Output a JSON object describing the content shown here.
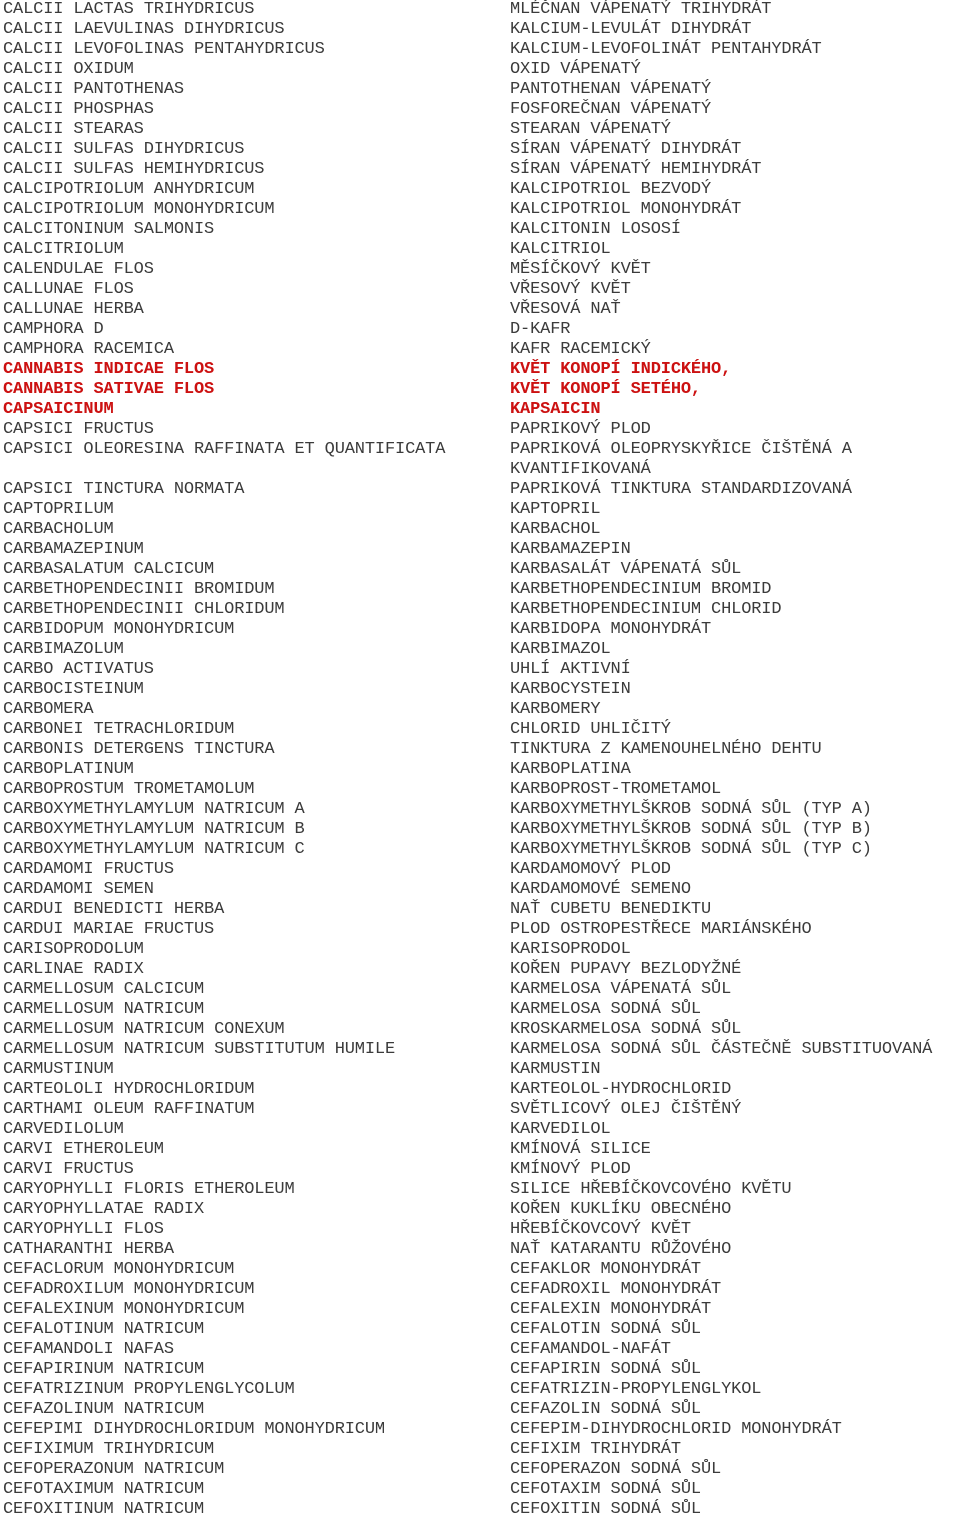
{
  "document": {
    "kind": "two-column-terminology-list",
    "language_left": "Latin",
    "language_right": "Czech",
    "highlight_color": "#cc1111",
    "text_color": "#3b3b3b",
    "background_color": "#ffffff"
  },
  "rows": [
    {
      "latin": "CALCII LACTAS TRIHYDRICUS",
      "czech": "MLÉČNAN VÁPENATÝ TRIHYDRÁT",
      "highlight": false
    },
    {
      "latin": "CALCII LAEVULINAS DIHYDRICUS",
      "czech": "KALCIUM-LEVULÁT DIHYDRÁT",
      "highlight": false
    },
    {
      "latin": "CALCII LEVOFOLINAS PENTAHYDRICUS",
      "czech": "KALCIUM-LEVOFOLINÁT PENTAHYDRÁT",
      "highlight": false
    },
    {
      "latin": "CALCII OXIDUM",
      "czech": "OXID VÁPENATÝ",
      "highlight": false
    },
    {
      "latin": "CALCII PANTOTHENAS",
      "czech": "PANTOTHENAN VÁPENATÝ",
      "highlight": false
    },
    {
      "latin": "CALCII PHOSPHAS",
      "czech": "FOSFOREČNAN VÁPENATÝ",
      "highlight": false
    },
    {
      "latin": "CALCII STEARAS",
      "czech": "STEARAN VÁPENATÝ",
      "highlight": false
    },
    {
      "latin": "CALCII SULFAS DIHYDRICUS",
      "czech": "SÍRAN VÁPENATÝ DIHYDRÁT",
      "highlight": false
    },
    {
      "latin": "CALCII SULFAS HEMIHYDRICUS",
      "czech": "SÍRAN VÁPENATÝ HEMIHYDRÁT",
      "highlight": false
    },
    {
      "latin": "CALCIPOTRIOLUM ANHYDRICUM",
      "czech": "KALCIPOTRIOL BEZVODÝ",
      "highlight": false
    },
    {
      "latin": "CALCIPOTRIOLUM MONOHYDRICUM",
      "czech": "KALCIPOTRIOL MONOHYDRÁT",
      "highlight": false
    },
    {
      "latin": "CALCITONINUM SALMONIS",
      "czech": "KALCITONIN LOSOSÍ",
      "highlight": false
    },
    {
      "latin": "CALCITRIOLUM",
      "czech": "KALCITRIOL",
      "highlight": false
    },
    {
      "latin": "CALENDULAE FLOS",
      "czech": "MĚSÍČKOVÝ KVĚT",
      "highlight": false
    },
    {
      "latin": "CALLUNAE FLOS",
      "czech": "VŘESOVÝ KVĚT",
      "highlight": false
    },
    {
      "latin": "CALLUNAE HERBA",
      "czech": "VŘESOVÁ NAŤ",
      "highlight": false
    },
    {
      "latin": "CAMPHORA D",
      "czech": "D-KAFR",
      "highlight": false
    },
    {
      "latin": "CAMPHORA RACEMICA",
      "czech": "KAFR RACEMICKÝ",
      "highlight": false
    },
    {
      "latin": "CANNABIS INDICAE FLOS",
      "czech": "KVĚT KONOPÍ INDICKÉHO,",
      "highlight": true
    },
    {
      "latin": "CANNABIS SATIVAE FLOS",
      "czech": "KVĚT KONOPÍ SETÉHO,",
      "highlight": true
    },
    {
      "latin": "CAPSAICINUM",
      "czech": "KAPSAICIN",
      "highlight": true
    },
    {
      "latin": "CAPSICI FRUCTUS",
      "czech": "PAPRIKOVÝ PLOD",
      "highlight": false
    },
    {
      "latin": "CAPSICI OLEORESINA RAFFINATA ET QUANTIFICATA",
      "czech": "PAPRIKOVÁ OLEOPRYSKYŘICE ČIŠTĚNÁ A KVANTIFIKOVANÁ",
      "highlight": false
    },
    {
      "latin": "CAPSICI TINCTURA NORMATA",
      "czech": "PAPRIKOVÁ TINKTURA STANDARDIZOVANÁ",
      "highlight": false
    },
    {
      "latin": "CAPTOPRILUM",
      "czech": "KAPTOPRIL",
      "highlight": false
    },
    {
      "latin": "CARBACHOLUM",
      "czech": "KARBACHOL",
      "highlight": false
    },
    {
      "latin": "CARBAMAZEPINUM",
      "czech": "KARBAMAZEPIN",
      "highlight": false
    },
    {
      "latin": "CARBASALATUM CALCICUM",
      "czech": "KARBASALÁT VÁPENATÁ SŮL",
      "highlight": false
    },
    {
      "latin": "CARBETHOPENDECINII BROMIDUM",
      "czech": "KARBETHOPENDECINIUM BROMID",
      "highlight": false
    },
    {
      "latin": "CARBETHOPENDECINII CHLORIDUM",
      "czech": "KARBETHOPENDECINIUM CHLORID",
      "highlight": false
    },
    {
      "latin": "CARBIDOPUM MONOHYDRICUM",
      "czech": "KARBIDOPA MONOHYDRÁT",
      "highlight": false
    },
    {
      "latin": "CARBIMAZOLUM",
      "czech": "KARBIMAZOL",
      "highlight": false
    },
    {
      "latin": "CARBO ACTIVATUS",
      "czech": "UHLÍ AKTIVNÍ",
      "highlight": false
    },
    {
      "latin": "CARBOCISTEINUM",
      "czech": "KARBOCYSTEIN",
      "highlight": false
    },
    {
      "latin": "CARBOMERA",
      "czech": "KARBOMERY",
      "highlight": false
    },
    {
      "latin": "CARBONEI TETRACHLORIDUM",
      "czech": "CHLORID UHLIČITÝ",
      "highlight": false
    },
    {
      "latin": "CARBONIS DETERGENS TINCTURA",
      "czech": "TINKTURA Z KAMENOUHELNÉHO DEHTU",
      "highlight": false
    },
    {
      "latin": "CARBOPLATINUM",
      "czech": "KARBOPLATINA",
      "highlight": false
    },
    {
      "latin": "CARBOPROSTUM TROMETAMOLUM",
      "czech": "KARBOPROST-TROMETAMOL",
      "highlight": false
    },
    {
      "latin": "CARBOXYMETHYLAMYLUM NATRICUM A",
      "czech": "KARBOXYMETHYLŠKROB SODNÁ SŮL (TYP A)",
      "highlight": false
    },
    {
      "latin": "CARBOXYMETHYLAMYLUM NATRICUM B",
      "czech": "KARBOXYMETHYLŠKROB SODNÁ SŮL (TYP B)",
      "highlight": false
    },
    {
      "latin": "CARBOXYMETHYLAMYLUM NATRICUM C",
      "czech": "KARBOXYMETHYLŠKROB SODNÁ SŮL (TYP C)",
      "highlight": false
    },
    {
      "latin": "CARDAMOMI FRUCTUS",
      "czech": "KARDAMOMOVÝ PLOD",
      "highlight": false
    },
    {
      "latin": "CARDAMOMI SEMEN",
      "czech": "KARDAMOMOVÉ SEMENO",
      "highlight": false
    },
    {
      "latin": "CARDUI BENEDICTI HERBA",
      "czech": "NAŤ CUBETU BENEDIKTU",
      "highlight": false
    },
    {
      "latin": "CARDUI MARIAE FRUCTUS",
      "czech": "PLOD OSTROPESTŘECE MARIÁNSKÉHO",
      "highlight": false
    },
    {
      "latin": "CARISOPRODOLUM",
      "czech": "KARISOPRODOL",
      "highlight": false
    },
    {
      "latin": "CARLINAE RADIX",
      "czech": "KOŘEN PUPAVY BEZLODYŽNÉ",
      "highlight": false
    },
    {
      "latin": "CARMELLOSUM CALCICUM",
      "czech": "KARMELOSA VÁPENATÁ SŮL",
      "highlight": false
    },
    {
      "latin": "CARMELLOSUM NATRICUM",
      "czech": "KARMELOSA SODNÁ SŮL",
      "highlight": false
    },
    {
      "latin": "CARMELLOSUM NATRICUM CONEXUM",
      "czech": "KROSKARMELOSA SODNÁ SŮL",
      "highlight": false
    },
    {
      "latin": "CARMELLOSUM NATRICUM SUBSTITUTUM HUMILE",
      "czech": "KARMELOSA SODNÁ SŮL ČÁSTEČNĚ SUBSTITUOVANÁ",
      "highlight": false
    },
    {
      "latin": "CARMUSTINUM",
      "czech": "KARMUSTIN",
      "highlight": false
    },
    {
      "latin": "CARTEOLOLI HYDROCHLORIDUM",
      "czech": "KARTEOLOL-HYDROCHLORID",
      "highlight": false
    },
    {
      "latin": "CARTHAMI OLEUM RAFFINATUM",
      "czech": "SVĚTLICOVÝ OLEJ ČIŠTĚNÝ",
      "highlight": false
    },
    {
      "latin": "CARVEDILOLUM",
      "czech": "KARVEDILOL",
      "highlight": false
    },
    {
      "latin": "CARVI ETHEROLEUM",
      "czech": "KMÍNOVÁ SILICE",
      "highlight": false
    },
    {
      "latin": "CARVI FRUCTUS",
      "czech": "KMÍNOVÝ PLOD",
      "highlight": false
    },
    {
      "latin": "CARYOPHYLLI FLORIS ETHEROLEUM",
      "czech": "SILICE HŘEBÍČKOVCOVÉHO KVĚTU",
      "highlight": false
    },
    {
      "latin": "CARYOPHYLLATAE RADIX",
      "czech": "KOŘEN KUKLÍKU OBECNÉHO",
      "highlight": false
    },
    {
      "latin": "CARYOPHYLLI FLOS",
      "czech": "HŘEBÍČKOVCOVÝ KVĚT",
      "highlight": false
    },
    {
      "latin": "CATHARANTHI HERBA",
      "czech": "NAŤ KATARANTU RŮŽOVÉHO",
      "highlight": false
    },
    {
      "latin": "CEFACLORUM MONOHYDRICUM",
      "czech": "CEFAKLOR MONOHYDRÁT",
      "highlight": false
    },
    {
      "latin": "CEFADROXILUM MONOHYDRICUM",
      "czech": "CEFADROXIL MONOHYDRÁT",
      "highlight": false
    },
    {
      "latin": "CEFALEXINUM MONOHYDRICUM",
      "czech": "CEFALEXIN MONOHYDRÁT",
      "highlight": false
    },
    {
      "latin": "CEFALOTINUM NATRICUM",
      "czech": "CEFALOTIN SODNÁ SŮL",
      "highlight": false
    },
    {
      "latin": "CEFAMANDOLI NAFAS",
      "czech": "CEFAMANDOL-NAFÁT",
      "highlight": false
    },
    {
      "latin": "CEFAPIRINUM NATRICUM",
      "czech": "CEFAPIRIN SODNÁ SŮL",
      "highlight": false
    },
    {
      "latin": "CEFATRIZINUM PROPYLENGLYCOLUM",
      "czech": "CEFATRIZIN-PROPYLENGLYKOL",
      "highlight": false
    },
    {
      "latin": "CEFAZOLINUM NATRICUM",
      "czech": "CEFAZOLIN SODNÁ SŮL",
      "highlight": false
    },
    {
      "latin": "CEFEPIMI DIHYDROCHLORIDUM MONOHYDRICUM",
      "czech": "CEFEPIM-DIHYDROCHLORID MONOHYDRÁT",
      "highlight": false
    },
    {
      "latin": "CEFIXIMUM TRIHYDRICUM",
      "czech": "CEFIXIM TRIHYDRÁT",
      "highlight": false
    },
    {
      "latin": "CEFOPERAZONUM NATRICUM",
      "czech": "CEFOPERAZON SODNÁ SŮL",
      "highlight": false
    },
    {
      "latin": "CEFOTAXIMUM NATRICUM",
      "czech": "CEFOTAXIM SODNÁ SŮL",
      "highlight": false
    },
    {
      "latin": "CEFOXITINUM NATRICUM",
      "czech": "CEFOXITIN SODNÁ SŮL",
      "highlight": false
    }
  ]
}
